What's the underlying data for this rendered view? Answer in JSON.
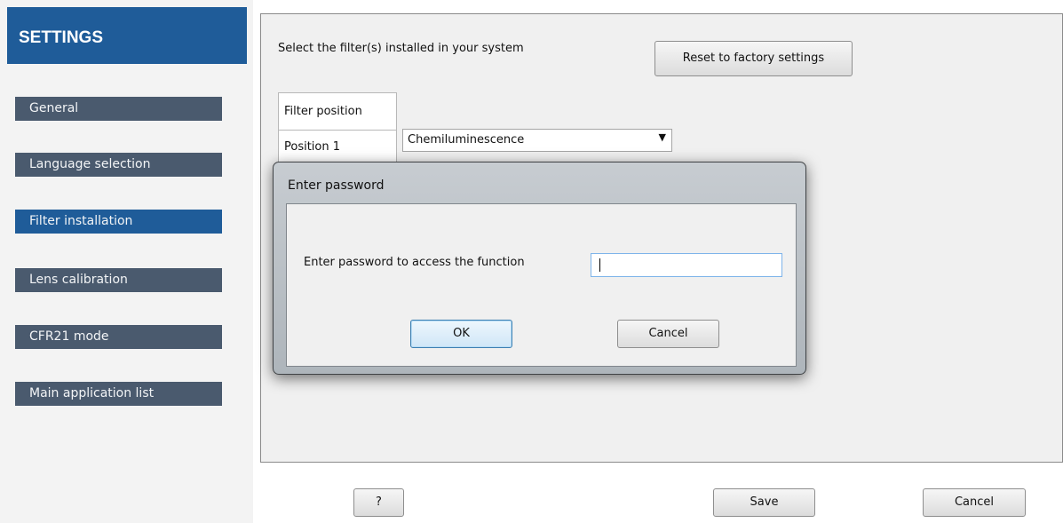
{
  "sidebar": {
    "title": "SETTINGS",
    "items": [
      {
        "label": "General",
        "active": false
      },
      {
        "label": "Language selection",
        "active": false
      },
      {
        "label": "Filter installation",
        "active": true
      },
      {
        "label": "Lens calibration",
        "active": false
      },
      {
        "label": "CFR21 mode",
        "active": false
      },
      {
        "label": "Main application list",
        "active": false
      }
    ]
  },
  "main": {
    "instruction": "Select the filter(s) installed in your system",
    "reset_button": "Reset to factory settings",
    "filter_table": {
      "header": "Filter position",
      "rows": [
        "Position 1"
      ]
    },
    "filter_select": {
      "value": "Chemiluminescence"
    }
  },
  "footer": {
    "help_button": "?",
    "save_button": "Save",
    "cancel_button": "Cancel"
  },
  "dialog": {
    "title": "Enter password",
    "label": "Enter password to access the function",
    "password_value": "",
    "ok_button": "OK",
    "cancel_button": "Cancel"
  },
  "colors": {
    "header_blue": "#1f5c99",
    "nav_inactive": "#4a5a6e",
    "nav_active": "#1f5c99"
  },
  "icons": {
    "dropdown": "chevron-down-icon"
  }
}
